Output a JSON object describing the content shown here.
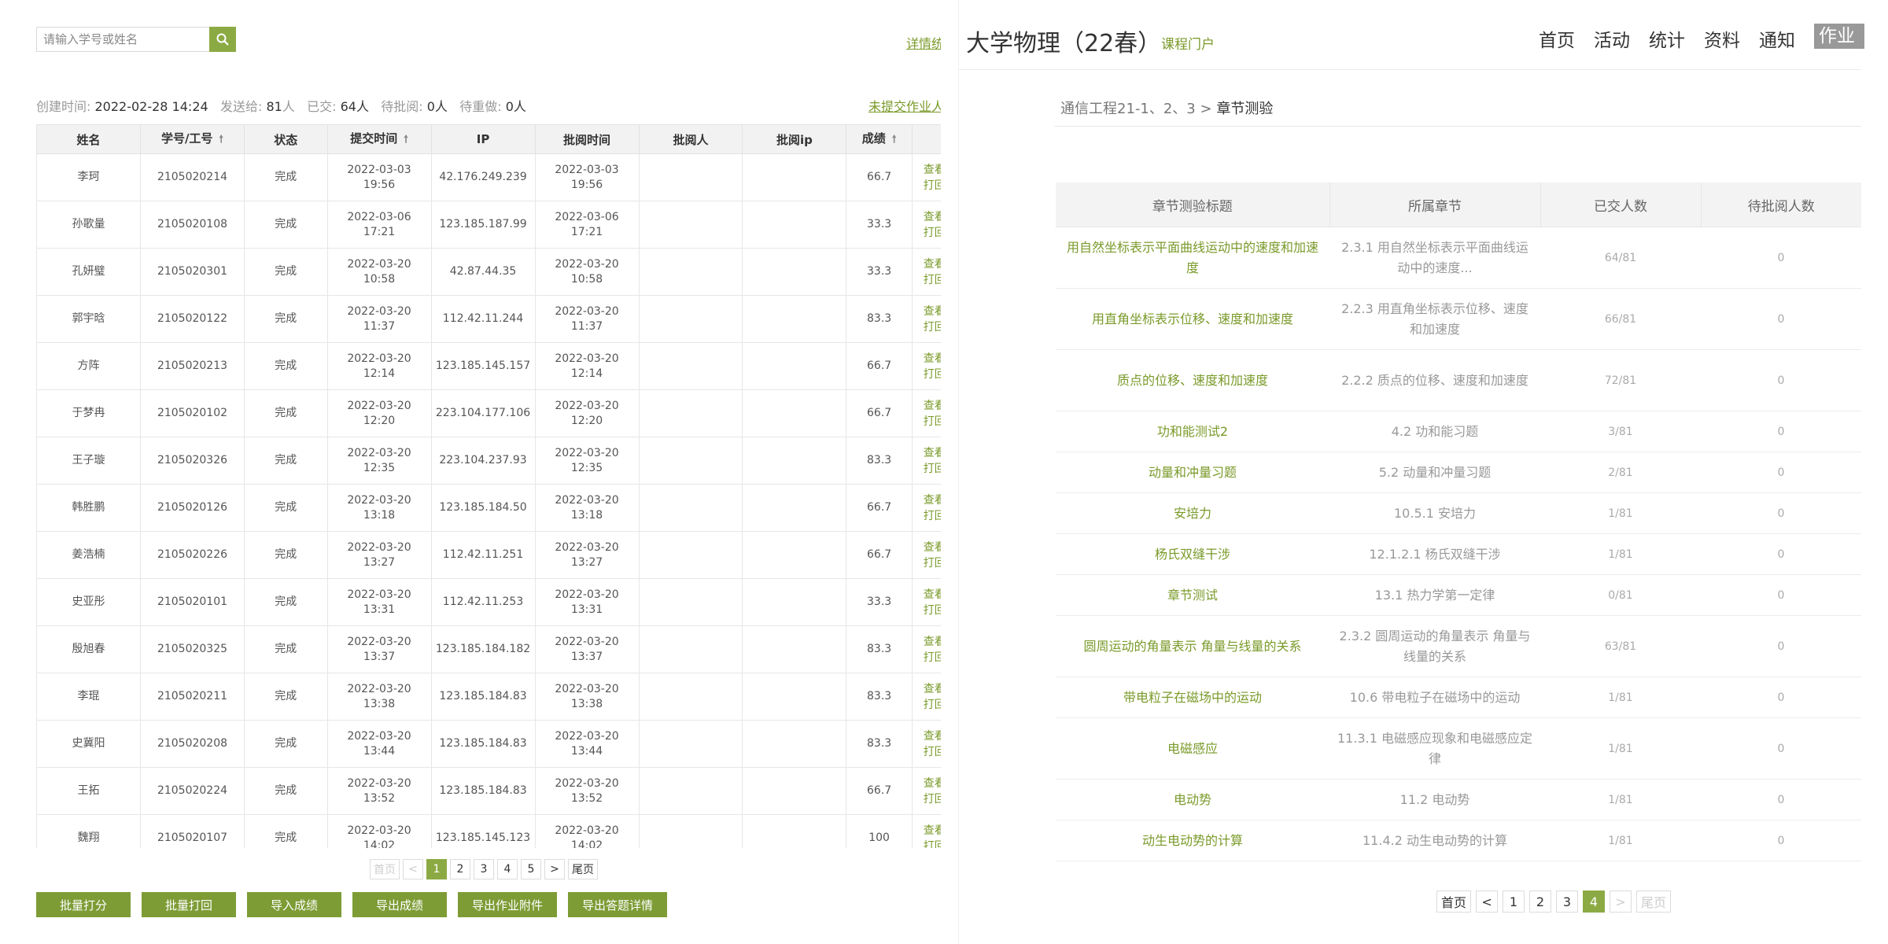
{
  "search": {
    "placeholder": "请输入学号或姓名"
  },
  "left_header": {
    "detail_link": "详情统计"
  },
  "info": {
    "created_label": "创建时间:",
    "created_value": "2022-02-28 14:24",
    "sent_label": "发送给:",
    "sent_value": "81",
    "sent_unit": "人",
    "submitted_label": "已交:",
    "submitted_value": "64人",
    "pending_label": "待批阅:",
    "pending_value": "0人",
    "redo_label": "待重做:",
    "redo_value": "0人",
    "unsubmitted_link": "未提交作业人员"
  },
  "left_table": {
    "headers": [
      "姓名",
      "学号/工号",
      "状态",
      "提交时间",
      "IP",
      "批阅时间",
      "批阅人",
      "批阅ip",
      "成绩",
      ""
    ],
    "ops": [
      "查看",
      "打回"
    ],
    "rows": [
      {
        "name": "李珂",
        "id": "2105020214",
        "status": "完成",
        "submit_date": "2022-03-03",
        "submit_time": "19:56",
        "ip": "42.176.249.239",
        "review_date": "2022-03-03",
        "review_time": "19:56",
        "reviewer": "",
        "review_ip": "",
        "score": "66.7"
      },
      {
        "name": "孙歌量",
        "id": "2105020108",
        "status": "完成",
        "submit_date": "2022-03-06",
        "submit_time": "17:21",
        "ip": "123.185.187.99",
        "review_date": "2022-03-06",
        "review_time": "17:21",
        "reviewer": "",
        "review_ip": "",
        "score": "33.3"
      },
      {
        "name": "孔妍璧",
        "id": "2105020301",
        "status": "完成",
        "submit_date": "2022-03-20",
        "submit_time": "10:58",
        "ip": "42.87.44.35",
        "review_date": "2022-03-20",
        "review_time": "10:58",
        "reviewer": "",
        "review_ip": "",
        "score": "33.3"
      },
      {
        "name": "郭宇晗",
        "id": "2105020122",
        "status": "完成",
        "submit_date": "2022-03-20",
        "submit_time": "11:37",
        "ip": "112.42.11.244",
        "review_date": "2022-03-20",
        "review_time": "11:37",
        "reviewer": "",
        "review_ip": "",
        "score": "83.3"
      },
      {
        "name": "方阵",
        "id": "2105020213",
        "status": "完成",
        "submit_date": "2022-03-20",
        "submit_time": "12:14",
        "ip": "123.185.145.157",
        "review_date": "2022-03-20",
        "review_time": "12:14",
        "reviewer": "",
        "review_ip": "",
        "score": "66.7"
      },
      {
        "name": "于梦冉",
        "id": "2105020102",
        "status": "完成",
        "submit_date": "2022-03-20",
        "submit_time": "12:20",
        "ip": "223.104.177.106",
        "review_date": "2022-03-20",
        "review_time": "12:20",
        "reviewer": "",
        "review_ip": "",
        "score": "66.7"
      },
      {
        "name": "王子璇",
        "id": "2105020326",
        "status": "完成",
        "submit_date": "2022-03-20",
        "submit_time": "12:35",
        "ip": "223.104.237.93",
        "review_date": "2022-03-20",
        "review_time": "12:35",
        "reviewer": "",
        "review_ip": "",
        "score": "83.3"
      },
      {
        "name": "韩胜鹏",
        "id": "2105020126",
        "status": "完成",
        "submit_date": "2022-03-20",
        "submit_time": "13:18",
        "ip": "123.185.184.50",
        "review_date": "2022-03-20",
        "review_time": "13:18",
        "reviewer": "",
        "review_ip": "",
        "score": "66.7"
      },
      {
        "name": "姜浩楠",
        "id": "2105020226",
        "status": "完成",
        "submit_date": "2022-03-20",
        "submit_time": "13:27",
        "ip": "112.42.11.251",
        "review_date": "2022-03-20",
        "review_time": "13:27",
        "reviewer": "",
        "review_ip": "",
        "score": "66.7"
      },
      {
        "name": "史亚彤",
        "id": "2105020101",
        "status": "完成",
        "submit_date": "2022-03-20",
        "submit_time": "13:31",
        "ip": "112.42.11.253",
        "review_date": "2022-03-20",
        "review_time": "13:31",
        "reviewer": "",
        "review_ip": "",
        "score": "33.3"
      },
      {
        "name": "殷旭春",
        "id": "2105020325",
        "status": "完成",
        "submit_date": "2022-03-20",
        "submit_time": "13:37",
        "ip": "123.185.184.182",
        "review_date": "2022-03-20",
        "review_time": "13:37",
        "reviewer": "",
        "review_ip": "",
        "score": "83.3"
      },
      {
        "name": "李琨",
        "id": "2105020211",
        "status": "完成",
        "submit_date": "2022-03-20",
        "submit_time": "13:38",
        "ip": "123.185.184.83",
        "review_date": "2022-03-20",
        "review_time": "13:38",
        "reviewer": "",
        "review_ip": "",
        "score": "83.3"
      },
      {
        "name": "史冀阳",
        "id": "2105020208",
        "status": "完成",
        "submit_date": "2022-03-20",
        "submit_time": "13:44",
        "ip": "123.185.184.83",
        "review_date": "2022-03-20",
        "review_time": "13:44",
        "reviewer": "",
        "review_ip": "",
        "score": "83.3"
      },
      {
        "name": "王拓",
        "id": "2105020224",
        "status": "完成",
        "submit_date": "2022-03-20",
        "submit_time": "13:52",
        "ip": "123.185.184.83",
        "review_date": "2022-03-20",
        "review_time": "13:52",
        "reviewer": "",
        "review_ip": "",
        "score": "66.7"
      },
      {
        "name": "魏翔",
        "id": "2105020107",
        "status": "完成",
        "submit_date": "2022-03-20",
        "submit_time": "14:02",
        "ip": "123.185.145.123",
        "review_date": "2022-03-20",
        "review_time": "14:02",
        "reviewer": "",
        "review_ip": "",
        "score": "100"
      }
    ]
  },
  "left_pager": {
    "first": "首页",
    "prev": "<",
    "pages": [
      "1",
      "2",
      "3",
      "4",
      "5"
    ],
    "current": "1",
    "next": ">",
    "last": "尾页"
  },
  "action_buttons": [
    "批量打分",
    "批量打回",
    "导入成绩",
    "导出成绩",
    "导出作业附件",
    "导出答题详情"
  ],
  "course": {
    "title": "大学物理（22春）",
    "portal": "课程门户"
  },
  "nav": [
    "首页",
    "活动",
    "统计",
    "资料",
    "通知",
    "作业"
  ],
  "nav_active": "作业",
  "breadcrumb": {
    "parent": "通信工程21-1、2、3",
    "sep": ">",
    "current": "章节测验"
  },
  "right_table": {
    "headers": [
      "章节测验标题",
      "所属章节",
      "已交人数",
      "待批阅人数"
    ],
    "rows": [
      {
        "title": "用自然坐标表示平面曲线运动中的速度和加速度",
        "chapter": "2.3.1 用自然坐标表示平面曲线运动中的速度...",
        "submitted": "64/81",
        "pending": "0"
      },
      {
        "title": "用直角坐标表示位移、速度和加速度",
        "chapter": "2.2.3 用直角坐标表示位移、速度和加速度",
        "submitted": "66/81",
        "pending": "0"
      },
      {
        "title": "质点的位移、速度和加速度",
        "chapter": "2.2.2 质点的位移、速度和加速度",
        "submitted": "72/81",
        "pending": "0"
      },
      {
        "title": "功和能测试2",
        "chapter": "4.2 功和能习题",
        "submitted": "3/81",
        "pending": "0"
      },
      {
        "title": "动量和冲量习题",
        "chapter": "5.2 动量和冲量习题",
        "submitted": "2/81",
        "pending": "0"
      },
      {
        "title": "安培力",
        "chapter": "10.5.1 安培力",
        "submitted": "1/81",
        "pending": "0"
      },
      {
        "title": "杨氏双缝干涉",
        "chapter": "12.1.2.1 杨氏双缝干涉",
        "submitted": "1/81",
        "pending": "0"
      },
      {
        "title": "章节测试",
        "chapter": "13.1 热力学第一定律",
        "submitted": "0/81",
        "pending": "0"
      },
      {
        "title": "圆周运动的角量表示 角量与线量的关系",
        "chapter": "2.3.2 圆周运动的角量表示 角量与线量的关系",
        "submitted": "63/81",
        "pending": "0"
      },
      {
        "title": "带电粒子在磁场中的运动",
        "chapter": "10.6 带电粒子在磁场中的运动",
        "submitted": "1/81",
        "pending": "0"
      },
      {
        "title": "电磁感应",
        "chapter": "11.3.1 电磁感应现象和电磁感应定律",
        "submitted": "1/81",
        "pending": "0"
      },
      {
        "title": "电动势",
        "chapter": "11.2 电动势",
        "submitted": "1/81",
        "pending": "0"
      },
      {
        "title": "动生电动势的计算",
        "chapter": "11.4.2 动生电动势的计算",
        "submitted": "1/81",
        "pending": "0"
      }
    ]
  },
  "right_pager": {
    "first": "首页",
    "prev": "<",
    "pages": [
      "1",
      "2",
      "3",
      "4"
    ],
    "current": "4",
    "next": ">",
    "last": "尾页"
  },
  "colors": {
    "accent": "#8caa44",
    "accent_dark": "#7d9c35",
    "link": "#7a9a2a"
  }
}
